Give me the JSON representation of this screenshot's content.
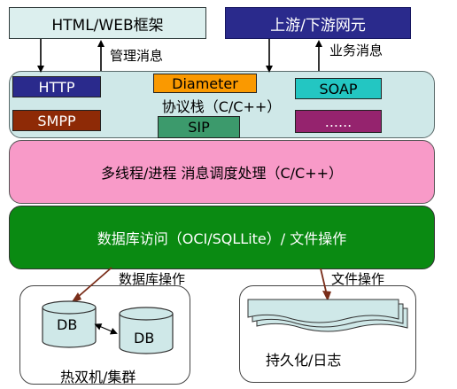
{
  "top": {
    "html_framework": "HTML/WEB框架",
    "upstream": "上游/下游网元",
    "manage_msg": "管理消息",
    "business_msg": "业务消息"
  },
  "stack": {
    "label": "协议栈（C/C++）",
    "protocols": {
      "http": "HTTP",
      "smpp": "SMPP",
      "diameter": "Diameter",
      "sip": "SIP",
      "soap": "SOAP",
      "more": "......"
    }
  },
  "layers": {
    "threading": "多线程/进程 消息调度处理（C/C++）",
    "database": "数据库访问（OCI/SQLLite）/ 文件操作"
  },
  "bottom": {
    "db_op": "数据库操作",
    "file_op": "文件操作",
    "db1": "DB",
    "db2": "DB",
    "cluster": "热双机/集群",
    "persist": "持久化/日志"
  },
  "colors": {
    "html_box": "#dcefee",
    "upstream_box": "#2a2a8c",
    "stack_bg": "#cfe8e8",
    "threading": "#f89ac8",
    "database": "#0a8a12",
    "diameter": "#fa9900",
    "soap": "#23c6c2",
    "sip": "#3c9a6c",
    "smpp": "#8e2a06",
    "more": "#95236e",
    "db_cylinder": "#cfe8e8"
  }
}
